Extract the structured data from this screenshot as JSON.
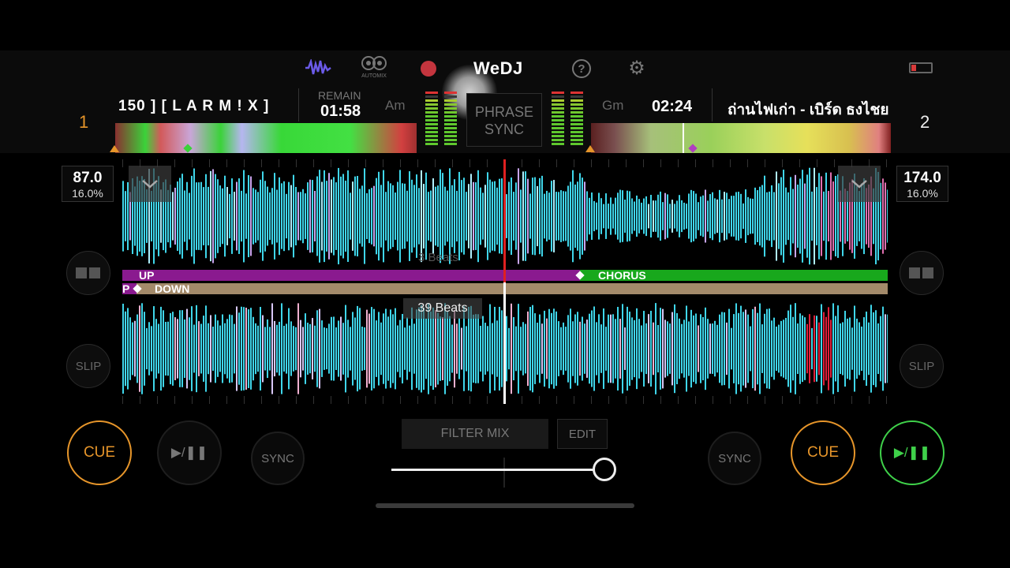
{
  "app": {
    "name": "WeDJ"
  },
  "header": {
    "automix_label": "AUTOMIX",
    "phrase_sync_line1": "PHRASE",
    "phrase_sync_line2": "SYNC"
  },
  "deck1": {
    "number": "1",
    "title": "150 ] [ L A R M ! X ]",
    "remain_label": "REMAIN",
    "time": "01:58",
    "key": "Am",
    "bpm": "87.0",
    "tempo_pct": "16.0%",
    "phrases_top": [
      {
        "label": "UP",
        "color": "#8a1a8f"
      },
      {
        "label": "CHORUS",
        "color": "#18a81c"
      }
    ],
    "phrases_bottom": [
      {
        "label": "P",
        "color": "#8a1a8f"
      },
      {
        "label": "DOWN",
        "color": "#a38a6a"
      }
    ],
    "beats_faded": "3 Beats",
    "cue_label": "CUE",
    "play_label": "▶/❚❚",
    "sync_label": "SYNC",
    "slip_label": "SLIP"
  },
  "deck2": {
    "number": "2",
    "title": "ถ่านไฟเก่า - เบิร์ด ธงไชย",
    "key": "Gm",
    "time": "02:24",
    "bpm": "174.0",
    "tempo_pct": "16.0%",
    "beats": "39 Beats",
    "cue_label": "CUE",
    "play_label": "▶/❚❚",
    "sync_label": "SYNC",
    "slip_label": "SLIP"
  },
  "mixer": {
    "filter_mix_label": "FILTER MIX",
    "edit_label": "EDIT",
    "crossfader_position": 0.95
  },
  "colors": {
    "cue_orange": "#e6952a",
    "play_green": "#3fd14a",
    "waveform_cyan": "#3fd6ea",
    "deck1_number": "#e6952a",
    "playhead": "#e02020"
  }
}
